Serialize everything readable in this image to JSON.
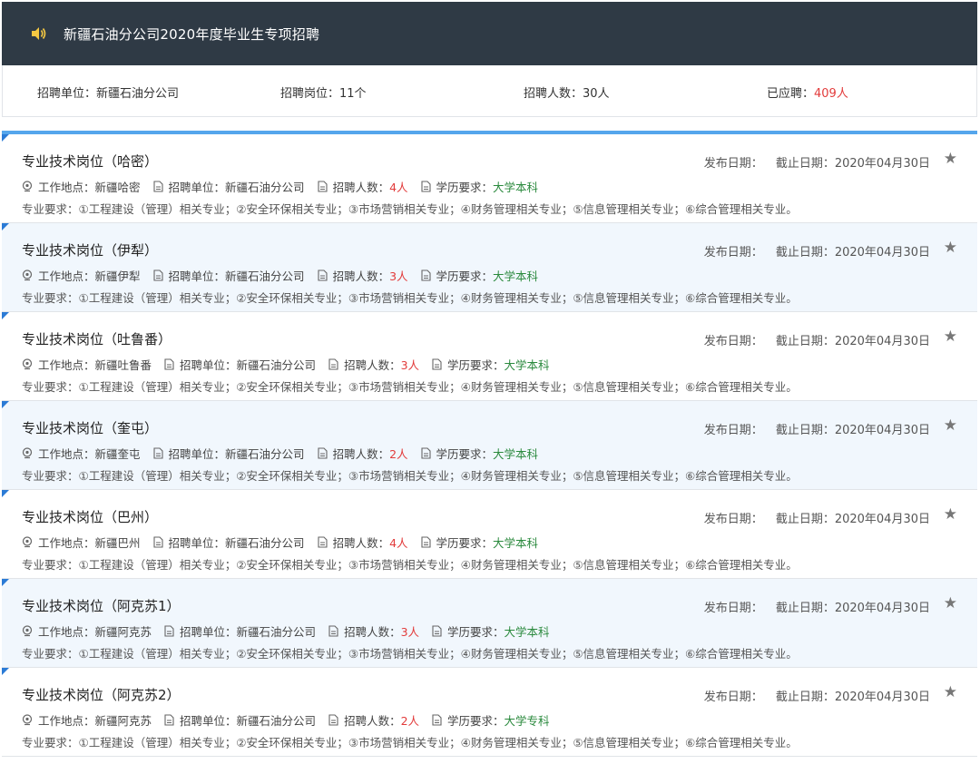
{
  "header": {
    "title": "新疆石油分公司2020年度毕业生专项招聘",
    "icon": "speaker-icon"
  },
  "summary": {
    "unit_label": "招聘单位：",
    "unit_value": "新疆石油分公司",
    "posts_label": "招聘岗位：",
    "posts_value": "11个",
    "headcount_label": "招聘人数：",
    "headcount_value": "30人",
    "applied_label": "已应聘：",
    "applied_value": "409人"
  },
  "labels": {
    "publish_date": "发布日期：",
    "deadline": "截止日期：",
    "location": "工作地点：",
    "unit": "招聘单位：",
    "headcount": "招聘人数：",
    "education": "学历要求：",
    "major": "专业要求："
  },
  "colors": {
    "header_bg": "#2f3a45",
    "accent": "#55a6ec",
    "count": "#e23b3b",
    "education": "#2b8a3e"
  },
  "jobs": [
    {
      "title": "专业技术岗位（哈密）",
      "publish_date": "",
      "deadline": "2020年04月30日",
      "location": "新疆哈密",
      "unit": "新疆石油分公司",
      "headcount": "4人",
      "education": "大学本科",
      "major": "①工程建设（管理）相关专业；②安全环保相关专业；③市场营销相关专业；④财务管理相关专业；⑤信息管理相关专业；⑥综合管理相关专业。"
    },
    {
      "title": "专业技术岗位（伊犁）",
      "publish_date": "",
      "deadline": "2020年04月30日",
      "location": "新疆伊犁",
      "unit": "新疆石油分公司",
      "headcount": "3人",
      "education": "大学本科",
      "major": "①工程建设（管理）相关专业；②安全环保相关专业；③市场营销相关专业；④财务管理相关专业；⑤信息管理相关专业；⑥综合管理相关专业。"
    },
    {
      "title": "专业技术岗位（吐鲁番）",
      "publish_date": "",
      "deadline": "2020年04月30日",
      "location": "新疆吐鲁番",
      "unit": "新疆石油分公司",
      "headcount": "3人",
      "education": "大学本科",
      "major": "①工程建设（管理）相关专业；②安全环保相关专业；③市场营销相关专业；④财务管理相关专业；⑤信息管理相关专业；⑥综合管理相关专业。"
    },
    {
      "title": "专业技术岗位（奎屯）",
      "publish_date": "",
      "deadline": "2020年04月30日",
      "location": "新疆奎屯",
      "unit": "新疆石油分公司",
      "headcount": "2人",
      "education": "大学本科",
      "major": "①工程建设（管理）相关专业；②安全环保相关专业；③市场营销相关专业；④财务管理相关专业；⑤信息管理相关专业；⑥综合管理相关专业。"
    },
    {
      "title": "专业技术岗位（巴州）",
      "publish_date": "",
      "deadline": "2020年04月30日",
      "location": "新疆巴州",
      "unit": "新疆石油分公司",
      "headcount": "4人",
      "education": "大学本科",
      "major": "①工程建设（管理）相关专业；②安全环保相关专业；③市场营销相关专业；④财务管理相关专业；⑤信息管理相关专业；⑥综合管理相关专业。"
    },
    {
      "title": "专业技术岗位（阿克苏1）",
      "publish_date": "",
      "deadline": "2020年04月30日",
      "location": "新疆阿克苏",
      "unit": "新疆石油分公司",
      "headcount": "3人",
      "education": "大学本科",
      "major": "①工程建设（管理）相关专业；②安全环保相关专业；③市场营销相关专业；④财务管理相关专业；⑤信息管理相关专业；⑥综合管理相关专业。"
    },
    {
      "title": "专业技术岗位（阿克苏2）",
      "publish_date": "",
      "deadline": "2020年04月30日",
      "location": "新疆阿克苏",
      "unit": "新疆石油分公司",
      "headcount": "2人",
      "education": "大学专科",
      "major": "①工程建设（管理）相关专业；②安全环保相关专业；③市场营销相关专业；④财务管理相关专业；⑤信息管理相关专业；⑥综合管理相关专业。"
    }
  ]
}
